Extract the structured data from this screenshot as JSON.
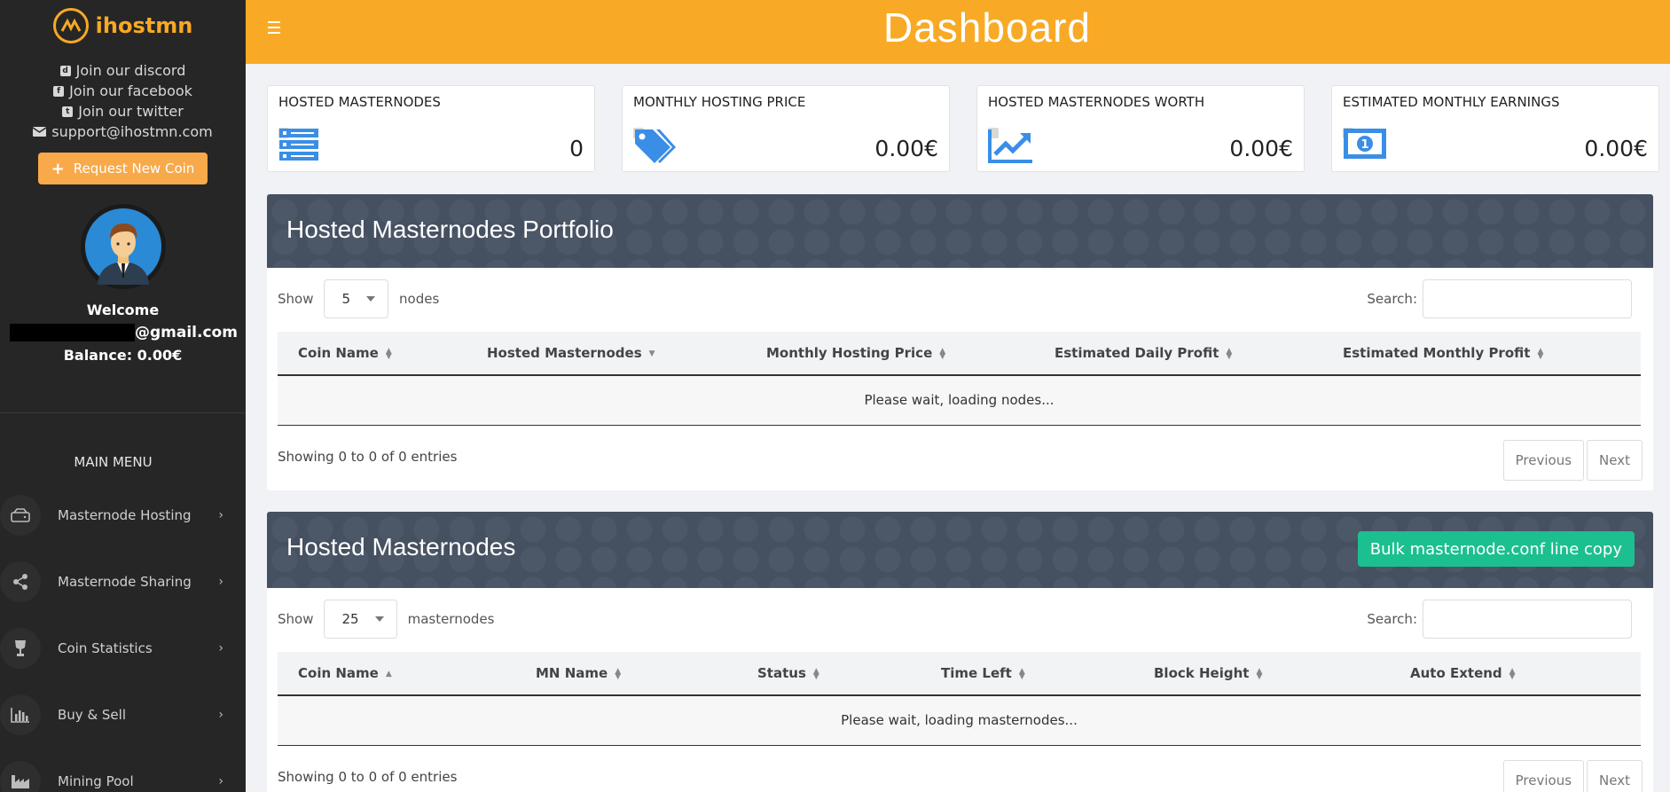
{
  "brand": {
    "name": "ihostmn",
    "accent": "#f8aa26"
  },
  "sidebar": {
    "social": [
      {
        "icon": "discord-icon",
        "label": "Join our discord"
      },
      {
        "icon": "facebook-icon",
        "label": "Join our facebook"
      },
      {
        "icon": "twitter-icon",
        "label": "Join our twitter"
      },
      {
        "icon": "mail-icon",
        "label": "support@ihostmn.com"
      }
    ],
    "request_button": "Request New Coin",
    "welcome": "Welcome",
    "email_suffix": "@gmail.com",
    "balance": "Balance: 0.00€",
    "menu_title": "MAIN MENU",
    "menu": [
      {
        "icon": "hard-drive-icon",
        "label": "Masternode Hosting"
      },
      {
        "icon": "share-icon",
        "label": "Masternode Sharing"
      },
      {
        "icon": "trophy-icon",
        "label": "Coin Statistics"
      },
      {
        "icon": "bar-chart-icon",
        "label": "Buy & Sell"
      },
      {
        "icon": "factory-icon",
        "label": "Mining Pool"
      }
    ]
  },
  "header": {
    "title": "Dashboard"
  },
  "stats": [
    {
      "label": "HOSTED MASTERNODES",
      "value": "0",
      "icon": "server-icon"
    },
    {
      "label": "MONTHLY HOSTING PRICE",
      "value": "0.00€",
      "icon": "tags-icon"
    },
    {
      "label": "HOSTED MASTERNODES WORTH",
      "value": "0.00€",
      "icon": "trend-up-icon"
    },
    {
      "label": "ESTIMATED MONTHLY EARNINGS",
      "value": "0.00€",
      "icon": "money-bill-icon"
    }
  ],
  "portfolio": {
    "title": "Hosted Masternodes Portfolio",
    "show_label": "Show",
    "page_size": "5",
    "page_size_suffix": "nodes",
    "search_label": "Search:",
    "columns": [
      "Coin Name",
      "Hosted Masternodes",
      "Monthly Hosting Price",
      "Estimated Daily Profit",
      "Estimated Monthly Profit"
    ],
    "empty_text": "Please wait, loading nodes...",
    "showing": "Showing 0 to 0 of 0 entries",
    "prev": "Previous",
    "next": "Next"
  },
  "masternodes": {
    "title": "Hosted Masternodes",
    "bulk_button": "Bulk masternode.conf line copy",
    "show_label": "Show",
    "page_size": "25",
    "page_size_suffix": "masternodes",
    "search_label": "Search:",
    "columns": [
      "Coin Name",
      "MN Name",
      "Status",
      "Time Left",
      "Block Height",
      "Auto Extend"
    ],
    "empty_text": "Please wait, loading masternodes...",
    "showing": "Showing 0 to 0 of 0 entries",
    "prev": "Previous",
    "next": "Next"
  }
}
